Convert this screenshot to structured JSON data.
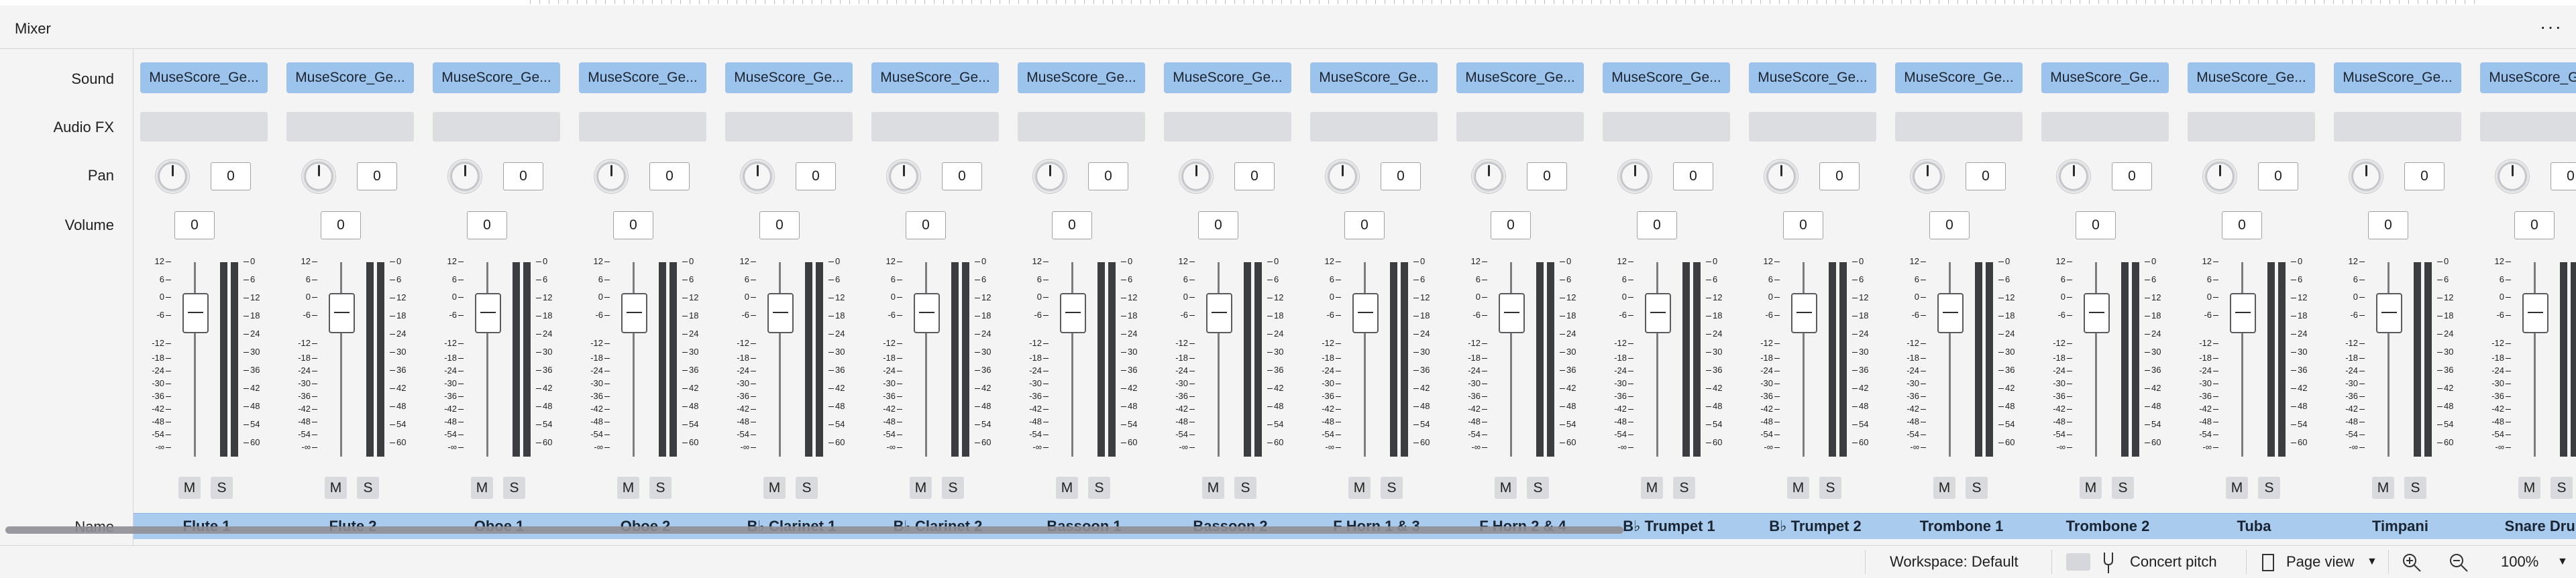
{
  "panel": {
    "title": "Mixer",
    "menu_label": "···"
  },
  "row_labels": {
    "sound": "Sound",
    "audio_fx": "Audio FX",
    "pan": "Pan",
    "volume": "Volume",
    "name": "Name"
  },
  "meter_scale_left": [
    "12",
    "6",
    "0",
    "-6",
    "-12",
    "-18",
    "-24",
    "-30",
    "-36",
    "-42",
    "-48",
    "-54",
    "-∞"
  ],
  "meter_scale_right": [
    "0",
    "6",
    "12",
    "18",
    "24",
    "30",
    "36",
    "42",
    "48",
    "54",
    "60"
  ],
  "mute_label": "M",
  "solo_label": "S",
  "channels": [
    {
      "sound": "MuseScore_Ge...",
      "pan": "0",
      "volume": "0",
      "name": "Flute 1"
    },
    {
      "sound": "MuseScore_Ge...",
      "pan": "0",
      "volume": "0",
      "name": "Flute 2"
    },
    {
      "sound": "MuseScore_Ge...",
      "pan": "0",
      "volume": "0",
      "name": "Oboe 1"
    },
    {
      "sound": "MuseScore_Ge...",
      "pan": "0",
      "volume": "0",
      "name": "Oboe 2"
    },
    {
      "sound": "MuseScore_Ge...",
      "pan": "0",
      "volume": "0",
      "name": "B♭ Clarinet 1"
    },
    {
      "sound": "MuseScore_Ge...",
      "pan": "0",
      "volume": "0",
      "name": "B♭ Clarinet 2"
    },
    {
      "sound": "MuseScore_Ge...",
      "pan": "0",
      "volume": "0",
      "name": "Bassoon 1"
    },
    {
      "sound": "MuseScore_Ge...",
      "pan": "0",
      "volume": "0",
      "name": "Bassoon 2"
    },
    {
      "sound": "MuseScore_Ge...",
      "pan": "0",
      "volume": "0",
      "name": "F Horn 1 & 3"
    },
    {
      "sound": "MuseScore_Ge...",
      "pan": "0",
      "volume": "0",
      "name": "F Horn 2 & 4"
    },
    {
      "sound": "MuseScore_Ge...",
      "pan": "0",
      "volume": "0",
      "name": "B♭ Trumpet 1"
    },
    {
      "sound": "MuseScore_Ge...",
      "pan": "0",
      "volume": "0",
      "name": "B♭ Trumpet 2"
    },
    {
      "sound": "MuseScore_Ge...",
      "pan": "0",
      "volume": "0",
      "name": "Trombone 1"
    },
    {
      "sound": "MuseScore_Ge...",
      "pan": "0",
      "volume": "0",
      "name": "Trombone 2"
    },
    {
      "sound": "MuseScore_Ge...",
      "pan": "0",
      "volume": "0",
      "name": "Tuba"
    },
    {
      "sound": "MuseScore_Ge...",
      "pan": "0",
      "volume": "0",
      "name": "Timpani"
    },
    {
      "sound": "MuseScore_Ge...",
      "pan": "0",
      "volume": "0",
      "name": "Snare Drum"
    }
  ],
  "status_bar": {
    "workspace": "Workspace: Default",
    "concert_pitch": "Concert pitch",
    "view_mode": "Page view",
    "zoom": "100%"
  },
  "colors": {
    "sound_button": "#9cc3ec",
    "name_bar": "#a9cbed",
    "meter": "#3c3d40",
    "background": "#f4f4f5"
  }
}
